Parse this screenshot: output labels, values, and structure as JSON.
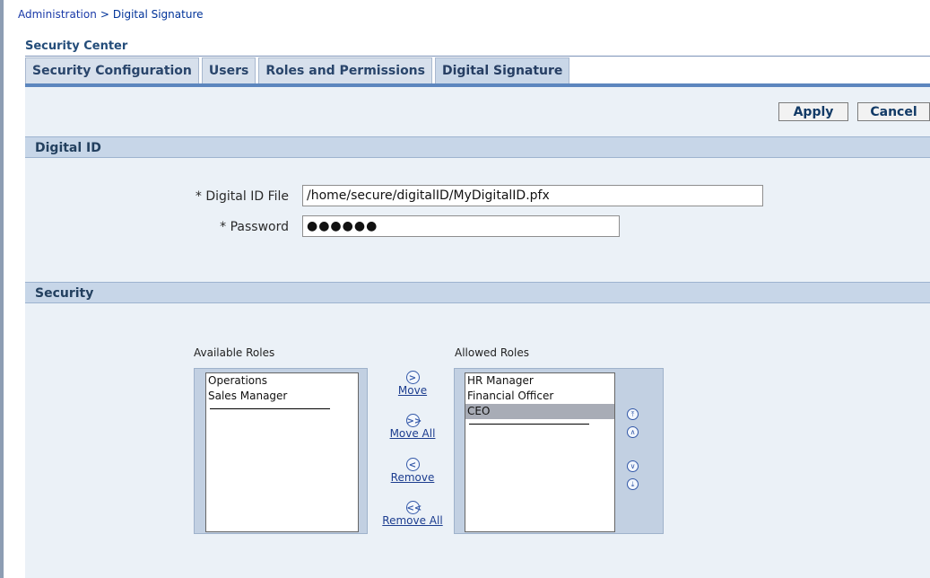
{
  "breadcrumb": {
    "parent": "Administration",
    "separator": ">",
    "current": "Digital Signature"
  },
  "section_title": "Security Center",
  "tabs": [
    {
      "label": "Security Configuration"
    },
    {
      "label": "Users"
    },
    {
      "label": "Roles and Permissions"
    },
    {
      "label": "Digital Signature",
      "active": true
    }
  ],
  "actions": {
    "apply": "Apply",
    "cancel": "Cancel"
  },
  "digital_id": {
    "header": "Digital ID",
    "file_label": "Digital ID File",
    "file_value": "/home/secure/digitalID/MyDigitalID.pfx",
    "password_label": "Password",
    "password_value": "●●●●●●",
    "required_marker": "*"
  },
  "security": {
    "header": "Security",
    "available_caption": "Available Roles",
    "allowed_caption": "Allowed Roles",
    "available_roles": [
      "Operations",
      "Sales Manager"
    ],
    "allowed_roles": [
      "HR Manager",
      "Financial Officer",
      "CEO"
    ],
    "selected_allowed": "CEO",
    "move": "Move",
    "move_all": "Move All",
    "remove": "Remove",
    "remove_all": "Remove All"
  },
  "colors": {
    "accent": "#5c86be",
    "link": "#1a3aa8",
    "header_bg": "#c7d6e8"
  }
}
